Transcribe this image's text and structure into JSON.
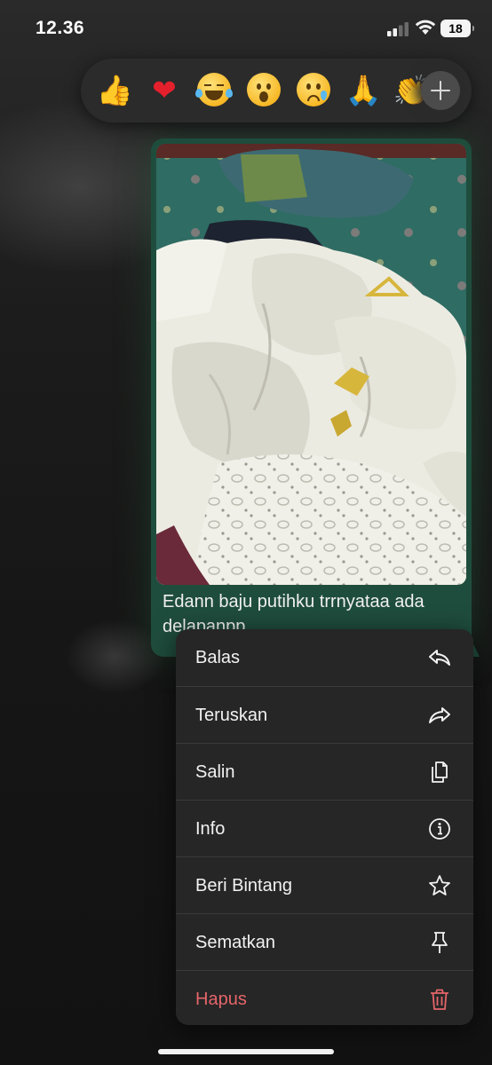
{
  "status_bar": {
    "time": "12.36",
    "battery_level": "18",
    "signal_icon": "cellular-signal-icon",
    "wifi_icon": "wifi-icon",
    "battery_icon": "battery-icon"
  },
  "reactions": [
    {
      "name": "thumbs-up",
      "glyph": "👍"
    },
    {
      "name": "red-heart",
      "glyph": "❤"
    },
    {
      "name": "face-with-tears-of-joy",
      "glyph": "😂"
    },
    {
      "name": "face-with-open-mouth",
      "glyph": "😮"
    },
    {
      "name": "crying-face",
      "glyph": "😢"
    },
    {
      "name": "folded-hands",
      "glyph": "🙏"
    },
    {
      "name": "clapping-hands",
      "glyph": "👏"
    }
  ],
  "add_reaction_icon": "plus-icon",
  "message": {
    "caption": "Edann baju putihku trrnyataa ada delapanpp",
    "photo_subject": "photo-of-white-clothes-on-bed",
    "bubble_color": "#1f4d3d"
  },
  "menu": {
    "items": [
      {
        "label": "Balas",
        "icon": "reply-icon",
        "color": "#f2f2f2"
      },
      {
        "label": "Teruskan",
        "icon": "forward-icon",
        "color": "#f2f2f2"
      },
      {
        "label": "Salin",
        "icon": "copy-icon",
        "color": "#f2f2f2"
      },
      {
        "label": "Info",
        "icon": "info-icon",
        "color": "#f2f2f2"
      },
      {
        "label": "Beri Bintang",
        "icon": "star-icon",
        "color": "#f2f2f2"
      },
      {
        "label": "Sematkan",
        "icon": "pin-icon",
        "color": "#f2f2f2"
      },
      {
        "label": "Hapus",
        "icon": "trash-icon",
        "color": "#e5656a"
      }
    ]
  }
}
